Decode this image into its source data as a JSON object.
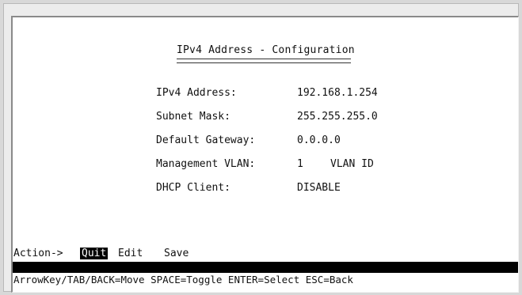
{
  "screen": {
    "title": "IPv4 Address - Configuration",
    "fields": [
      {
        "label": "IPv4 Address:",
        "value": "192.168.1.254"
      },
      {
        "label": "Subnet Mask:",
        "value": "255.255.255.0"
      },
      {
        "label": "Default Gateway:",
        "value": "0.0.0.0"
      },
      {
        "label": "Management VLAN:",
        "value": "1",
        "unit": "VLAN ID"
      },
      {
        "label": "DHCP Client:",
        "value": "DISABLE"
      }
    ],
    "actions": {
      "prefix": "Action->",
      "quit": "Quit",
      "edit": "Edit",
      "save": "Save"
    },
    "help": "ArrowKey/TAB/BACK=Move  SPACE=Toggle  ENTER=Select  ESC=Back"
  }
}
